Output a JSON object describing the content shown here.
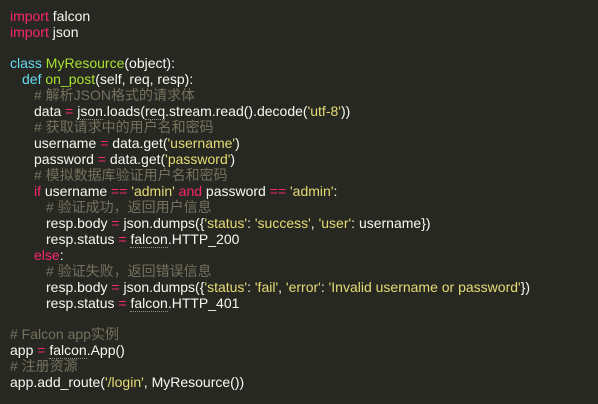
{
  "theme": {
    "background": "#272822",
    "text": "#f8f8f2",
    "keyword": "#f92672",
    "definition": "#66d9ef",
    "function_name": "#a6e22e",
    "string": "#e6db74",
    "comment": "#75715e"
  },
  "code": {
    "l1": {
      "kw": "import",
      "rest": " falcon"
    },
    "l2": {
      "kw": "import",
      "rest": " json"
    },
    "l4": {
      "kw": "class",
      "name": "MyResource",
      "rest": "(object):"
    },
    "l5": {
      "kw": "def",
      "name": "on_post",
      "rest": "(self, req, resp):"
    },
    "l6": {
      "comment": "# 解析JSON格式的请求体"
    },
    "l7": {
      "a": "data",
      "eq": " = ",
      "b": "json",
      "c": ".loads(",
      "d": "req",
      "e": ".stream.read().decode(",
      "s": "'utf-8'",
      "f": "))"
    },
    "l8": {
      "comment": "# 获取请求中的用户名和密码"
    },
    "l9": {
      "a": "username",
      "eq": " = ",
      "b": "data.get(",
      "s": "'username'",
      "f": ")"
    },
    "l10": {
      "a": "password",
      "eq": " = ",
      "b": "data.get(",
      "s": "'password'",
      "f": ")"
    },
    "l11": {
      "comment": "# 模拟数据库验证用户名和密码"
    },
    "l12": {
      "kw": "if",
      "a": " username ",
      "op1": "==",
      "s1": " 'admin' ",
      "kw2": "and",
      "b": " password ",
      "op2": "==",
      "s2": " 'admin'",
      "f": ":"
    },
    "l13": {
      "comment": "# 验证成功，返回用户信息"
    },
    "l14": {
      "a": "resp.body",
      "eq": " = ",
      "b": "json",
      "c": ".dumps({",
      "s1": "'status'",
      "d": ": ",
      "s2": "'success'",
      "e": ", ",
      "s3": "'user'",
      "f": ": username})"
    },
    "l15": {
      "a": "resp.status",
      "eq": " = ",
      "b": "falcon",
      "c": ".HTTP_200"
    },
    "l16": {
      "kw": "else",
      "f": ":"
    },
    "l17": {
      "comment": "# 验证失败，返回错误信息"
    },
    "l18": {
      "a": "resp.body",
      "eq": " = ",
      "b": "json",
      "c": ".dumps({",
      "s1": "'status'",
      "d": ": ",
      "s2": "'fail'",
      "e": ", ",
      "s3": "'error'",
      "g": ": ",
      "s4": "'Invalid username or password'",
      "f": "})"
    },
    "l19": {
      "a": "resp.status",
      "eq": " = ",
      "b": "falcon",
      "c": ".HTTP_401"
    },
    "l21": {
      "comment": "# Falcon app实例"
    },
    "l22": {
      "a": "app",
      "eq": " = ",
      "b": "falcon",
      "c": ".App()"
    },
    "l23": {
      "comment": "# 注册资源"
    },
    "l24": {
      "a": "app.add_route(",
      "s": "'/login'",
      "f": ", MyResource())"
    }
  }
}
